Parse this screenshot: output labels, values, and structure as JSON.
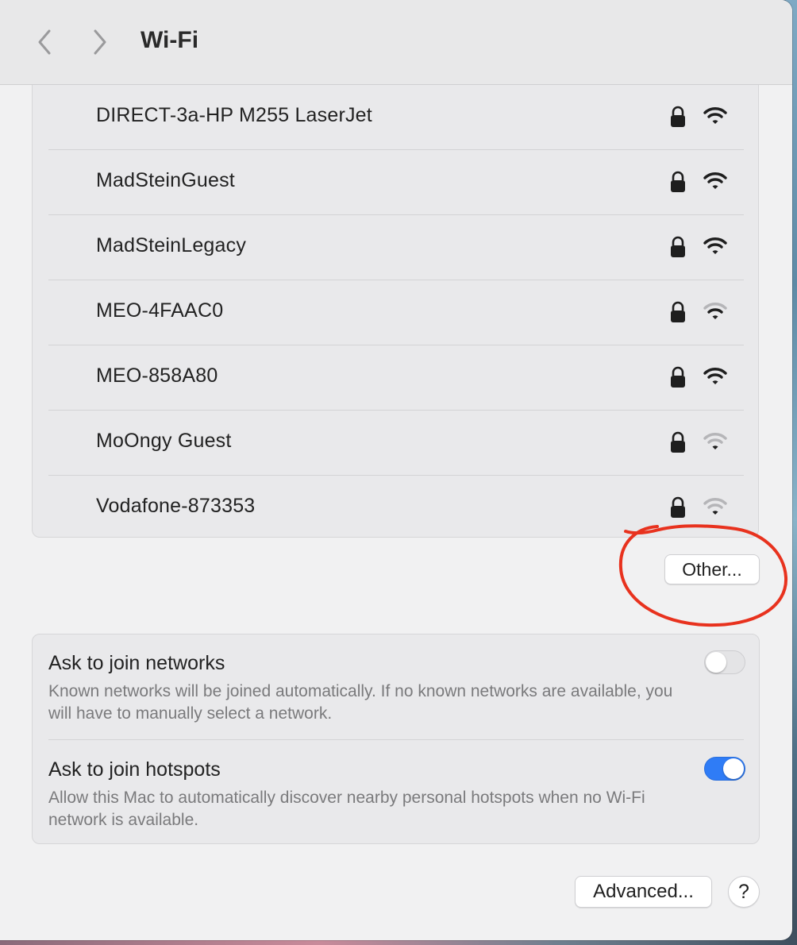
{
  "window": {
    "title": "Wi-Fi"
  },
  "toolbar": {
    "back_icon": "chevron-left-icon",
    "forward_icon": "chevron-right-icon"
  },
  "networks": [
    {
      "name": "DIRECT-3a-HP M255 LaserJet",
      "locked": true,
      "signal": "strong"
    },
    {
      "name": "MadSteinGuest",
      "locked": true,
      "signal": "strong"
    },
    {
      "name": "MadSteinLegacy",
      "locked": true,
      "signal": "strong"
    },
    {
      "name": "MEO-4FAAC0",
      "locked": true,
      "signal": "medium"
    },
    {
      "name": "MEO-858A80",
      "locked": true,
      "signal": "strong"
    },
    {
      "name": "MoOngy Guest",
      "locked": true,
      "signal": "weak"
    },
    {
      "name": "Vodafone-873353",
      "locked": true,
      "signal": "weak"
    }
  ],
  "other_button": {
    "label": "Other..."
  },
  "settings": {
    "ask_join_networks": {
      "title": "Ask to join networks",
      "description": "Known networks will be joined automatically. If no known networks are available, you will have to manually select a network.",
      "enabled": false
    },
    "ask_join_hotspots": {
      "title": "Ask to join hotspots",
      "description": "Allow this Mac to automatically discover nearby personal hotspots when no Wi-Fi network is available.",
      "enabled": true
    }
  },
  "footer": {
    "advanced_label": "Advanced...",
    "help_label": "?"
  },
  "colors": {
    "accent": "#2f7cf6",
    "annotation": "#e8321e",
    "icon_strong": "#1e1e1e",
    "icon_dim": "#b5b5b8"
  }
}
